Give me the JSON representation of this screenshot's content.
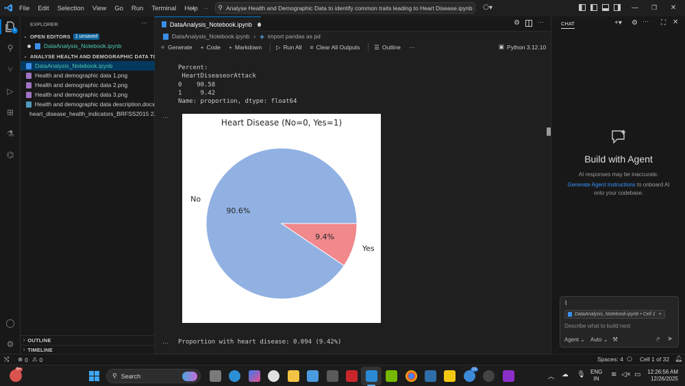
{
  "titlebar": {
    "menu": [
      "File",
      "Edit",
      "Selection",
      "View",
      "Go",
      "Run",
      "Terminal",
      "Help"
    ],
    "search_text": "Analyse Health and Demographic Data to identify common traits leading to Heart Disease.ipynb"
  },
  "sidebar": {
    "title": "EXPLORER",
    "open_editors_label": "OPEN EDITORS",
    "unsaved_badge": "1 unsaved",
    "open_file": "DataAnalysis_Notebook.ipynb",
    "folder_label": "ANALYSE HEALTH AND DEMOGRAPHIC DATA TO ID...",
    "files": [
      "DataAnalysis_Notebook.ipynb",
      "Health and demographic data 1.png",
      "Health and demographic data 2.png",
      "Health and demographic data 3.png",
      "Health and demographic data description.docx",
      "heart_disease_health_indicators_BRFSS2015 2..."
    ],
    "outline_label": "OUTLINE",
    "timeline_label": "TIMELINE"
  },
  "editor": {
    "tab_label": "DataAnalysis_Notebook.ipynb",
    "breadcrumb_file": "DataAnalysis_Notebook.ipynb",
    "breadcrumb_cell": "import pandas as pd",
    "toolbar": {
      "generate": "Generate",
      "code": "Code",
      "markdown": "Markdown",
      "run_all": "Run All",
      "clear_all": "Clear All Outputs",
      "outline": "Outline",
      "more": "···",
      "kernel": "Python 3.12.10"
    },
    "output_lines": [
      "Percent:",
      " HeartDiseaseorAttack",
      "0    90.58",
      "1     9.42",
      "Name: proportion, dtype: float64"
    ],
    "cell_ellipsis": "···",
    "bottom_output": "Proportion with heart disease: 0.094 (9.42%)"
  },
  "chart_data": {
    "type": "pie",
    "title": "Heart Disease (No=0, Yes=1)",
    "categories": [
      "No",
      "Yes"
    ],
    "values": [
      90.58,
      9.42
    ],
    "labels_pct": [
      "90.6%",
      "9.4%"
    ],
    "colors": [
      "#92b1e3",
      "#f0888c"
    ],
    "legend": "none"
  },
  "chat": {
    "title": "CHAT",
    "heading": "Build with Agent",
    "subtext": "AI responses may be inaccurate.",
    "link": "Generate Agent Instructions",
    "link_tail": "to onboard AI",
    "line3": "onto your codebase.",
    "context_chip": "DataAnalysis_Notebook.ipynb • Cell 1",
    "input_placeholder": "Describe what to build next",
    "agent_label": "Agent",
    "auto_label": "Auto"
  },
  "statusbar": {
    "errors": "0",
    "warnings": "0",
    "spaces": "Spaces: 4",
    "cell": "Cell 1 of 32"
  },
  "taskbar": {
    "search_label": "Search",
    "lang_top": "ENG",
    "lang_bottom": "IN",
    "time": "12:26:56 AM",
    "date": "12/26/2025",
    "notif_badge": "25",
    "weather_badge": "9+"
  },
  "colors": {
    "accent": "#0078d4",
    "link": "#3794ff",
    "pie_no": "#92b1e3",
    "pie_yes": "#f0888c"
  }
}
